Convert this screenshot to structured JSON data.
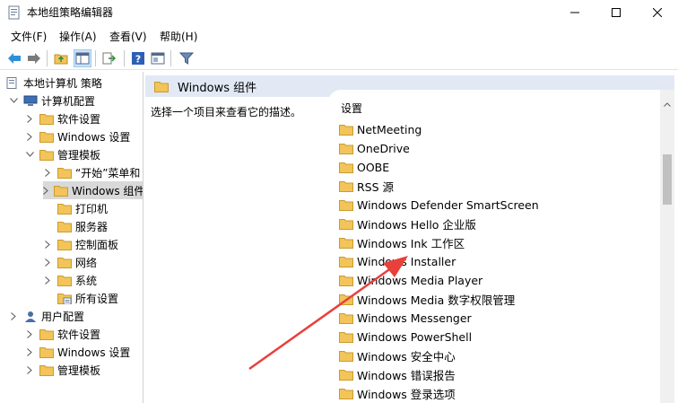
{
  "window": {
    "title": "本地组策略编辑器",
    "icon": "gpedit-icon"
  },
  "menubar": {
    "items": [
      "文件(F)",
      "操作(A)",
      "查看(V)",
      "帮助(H)"
    ]
  },
  "toolbar": {
    "buttons": [
      "back-icon",
      "forward-icon",
      "up-folder-icon",
      "show-hide-tree-icon",
      "export-icon",
      "help-icon",
      "properties-icon",
      "filter-icon"
    ]
  },
  "tree": {
    "items": [
      {
        "label": "本地计算机 策略",
        "icon": "policy-doc-icon"
      },
      {
        "label": "计算机配置",
        "icon": "computer-icon"
      },
      {
        "label": "软件设置",
        "icon": "folder-icon"
      },
      {
        "label": "Windows 设置",
        "icon": "folder-icon"
      },
      {
        "label": "管理模板",
        "icon": "folder-icon"
      },
      {
        "label": "“开始”菜单和",
        "icon": "folder-icon"
      },
      {
        "label": "Windows 组件",
        "icon": "folder-icon"
      },
      {
        "label": "打印机",
        "icon": "folder-icon"
      },
      {
        "label": "服务器",
        "icon": "folder-icon"
      },
      {
        "label": "控制面板",
        "icon": "folder-icon"
      },
      {
        "label": "网络",
        "icon": "folder-icon"
      },
      {
        "label": "系统",
        "icon": "folder-icon"
      },
      {
        "label": "所有设置",
        "icon": "settings-folder-icon"
      },
      {
        "label": "用户配置",
        "icon": "user-icon"
      },
      {
        "label": "软件设置",
        "icon": "folder-icon"
      },
      {
        "label": "Windows 设置",
        "icon": "folder-icon"
      },
      {
        "label": "管理模板",
        "icon": "folder-icon"
      }
    ]
  },
  "details": {
    "header_title": "Windows 组件",
    "description": "选择一个项目来查看它的描述。",
    "column_header": "设置",
    "items": [
      "NetMeeting",
      "OneDrive",
      "OOBE",
      "RSS 源",
      "Windows Defender SmartScreen",
      "Windows Hello 企业版",
      "Windows Ink 工作区",
      "Windows Installer",
      "Windows Media Player",
      "Windows Media 数字权限管理",
      "Windows Messenger",
      "Windows PowerShell",
      "Windows 安全中心",
      "Windows 错误报告",
      "Windows 登录选项"
    ]
  },
  "colors": {
    "header_band": "#e2e9f5",
    "folder": "#f2c45a",
    "selected_row": "#d9d9d9",
    "arrow": "#e8403a"
  }
}
